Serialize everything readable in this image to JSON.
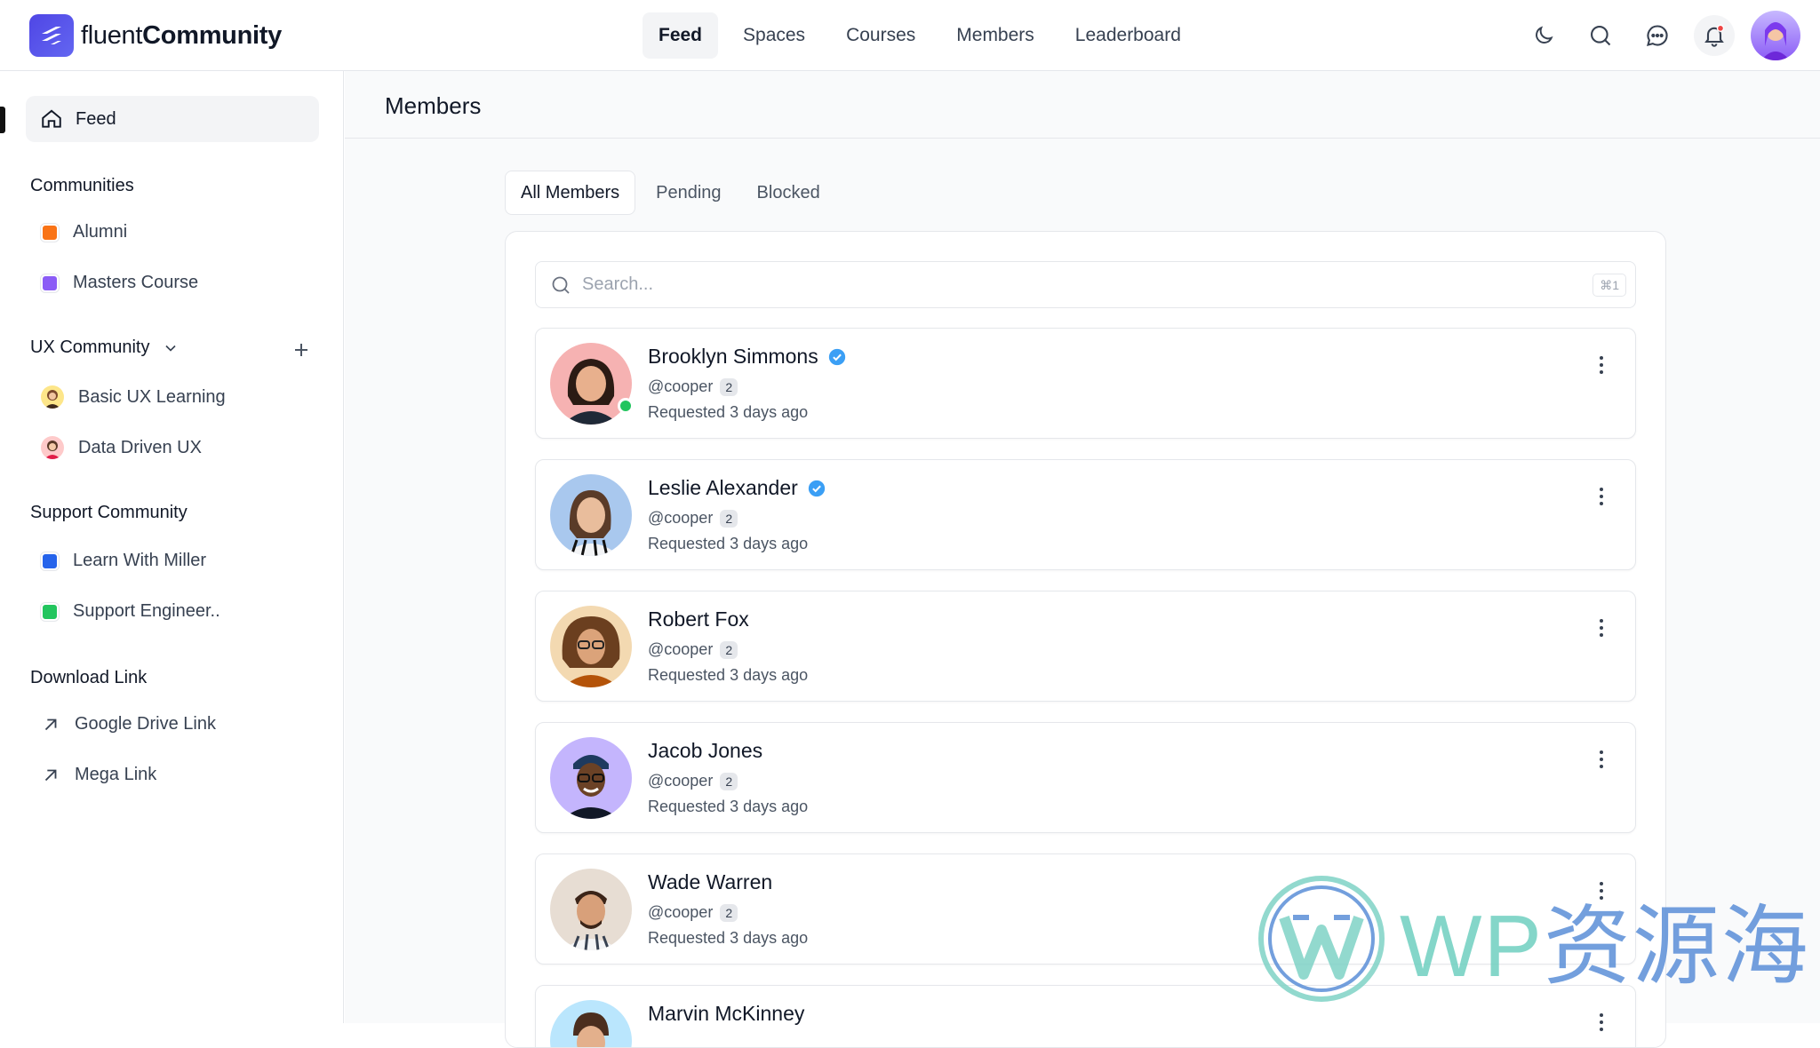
{
  "app": {
    "brand_light": "fluent",
    "brand_bold": "Community"
  },
  "topnav": [
    {
      "label": "Feed",
      "active": true
    },
    {
      "label": "Spaces"
    },
    {
      "label": "Courses"
    },
    {
      "label": "Members"
    },
    {
      "label": "Leaderboard"
    }
  ],
  "sidebar": {
    "feed": "Feed",
    "sections": [
      {
        "title": "Communities",
        "items": [
          "Alumni",
          "Masters Course"
        ]
      },
      {
        "title": "UX Community",
        "items": [
          "Basic UX Learning",
          "Data Driven UX"
        ]
      },
      {
        "title": "Support Community",
        "items": [
          "Learn With Miller",
          "Support Engineer.."
        ]
      },
      {
        "title": "Download Link",
        "items": [
          "Google Drive Link",
          "Mega Link"
        ]
      }
    ],
    "colors": {
      "alumni": "#f97316",
      "masters": "#8b5cf6",
      "miller": "#2563eb",
      "support": "#22c55e"
    }
  },
  "page": {
    "title": "Members"
  },
  "tabs": [
    "All Members",
    "Pending",
    "Blocked"
  ],
  "search": {
    "placeholder": "Search...",
    "shortcut": "⌘1"
  },
  "members": [
    {
      "name": "Brooklyn Simmons",
      "verified": true,
      "handle": "@cooper",
      "count": "2",
      "status": "Requested 3 days ago",
      "online": true
    },
    {
      "name": "Leslie Alexander",
      "verified": true,
      "handle": "@cooper",
      "count": "2",
      "status": "Requested 3 days ago"
    },
    {
      "name": "Robert Fox",
      "verified": false,
      "handle": "@cooper",
      "count": "2",
      "status": "Requested 3 days ago"
    },
    {
      "name": "Jacob Jones",
      "verified": false,
      "handle": "@cooper",
      "count": "2",
      "status": "Requested 3 days ago"
    },
    {
      "name": "Wade Warren",
      "verified": false,
      "handle": "@cooper",
      "count": "2",
      "status": "Requested 3 days ago"
    },
    {
      "name": "Marvin McKinney",
      "verified": false,
      "handle": "",
      "count": "",
      "status": ""
    }
  ],
  "watermark": {
    "latin": "WP",
    "cjk": "资源海"
  }
}
